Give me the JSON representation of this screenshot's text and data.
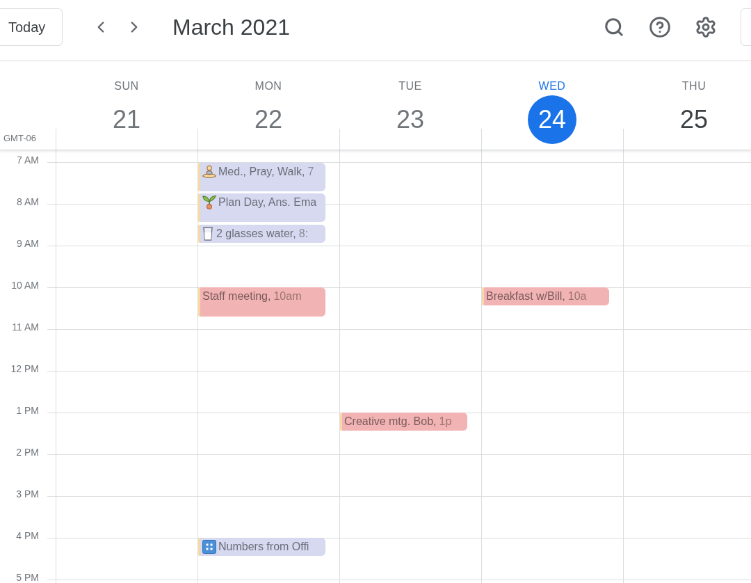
{
  "toolbar": {
    "today_button": "Today",
    "title": "March 2021"
  },
  "timezone": "GMT-06",
  "days": [
    {
      "name": "SUN",
      "number": "21",
      "past": true,
      "today": false
    },
    {
      "name": "MON",
      "number": "22",
      "past": true,
      "today": false,
      "events": [
        {
          "title": "Med., Pray, Walk,",
          "time": "7",
          "color": "#d6d9ef"
        },
        {
          "title": "Plan Day, Ans. Ema",
          "color": "#d6d9ef"
        },
        {
          "title": "2 glasses water,",
          "time": "8:",
          "color": "#d6d9ef"
        },
        {
          "title": "Staff meeting,",
          "time": "10am",
          "color": "#f2b3b4"
        },
        {
          "title": "Numbers from Offi",
          "color": "#d6d9ef"
        }
      ]
    },
    {
      "name": "TUE",
      "number": "23",
      "past": true,
      "today": false,
      "events": [
        {
          "title": "Creative mtg. Bob,",
          "time": "1p",
          "color": "#f2b3b4"
        }
      ]
    },
    {
      "name": "WED",
      "number": "24",
      "past": false,
      "today": true,
      "events": [
        {
          "title": "Breakfast w/Bill,",
          "time": "10a",
          "color": "#f2b3b4"
        }
      ]
    },
    {
      "name": "THU",
      "number": "25",
      "past": false,
      "today": false
    }
  ],
  "hours": [
    "7 AM",
    "8 AM",
    "9 AM",
    "10 AM",
    "11 AM",
    "12 PM",
    "1 PM",
    "2 PM",
    "3 PM",
    "4 PM",
    "5 PM"
  ]
}
